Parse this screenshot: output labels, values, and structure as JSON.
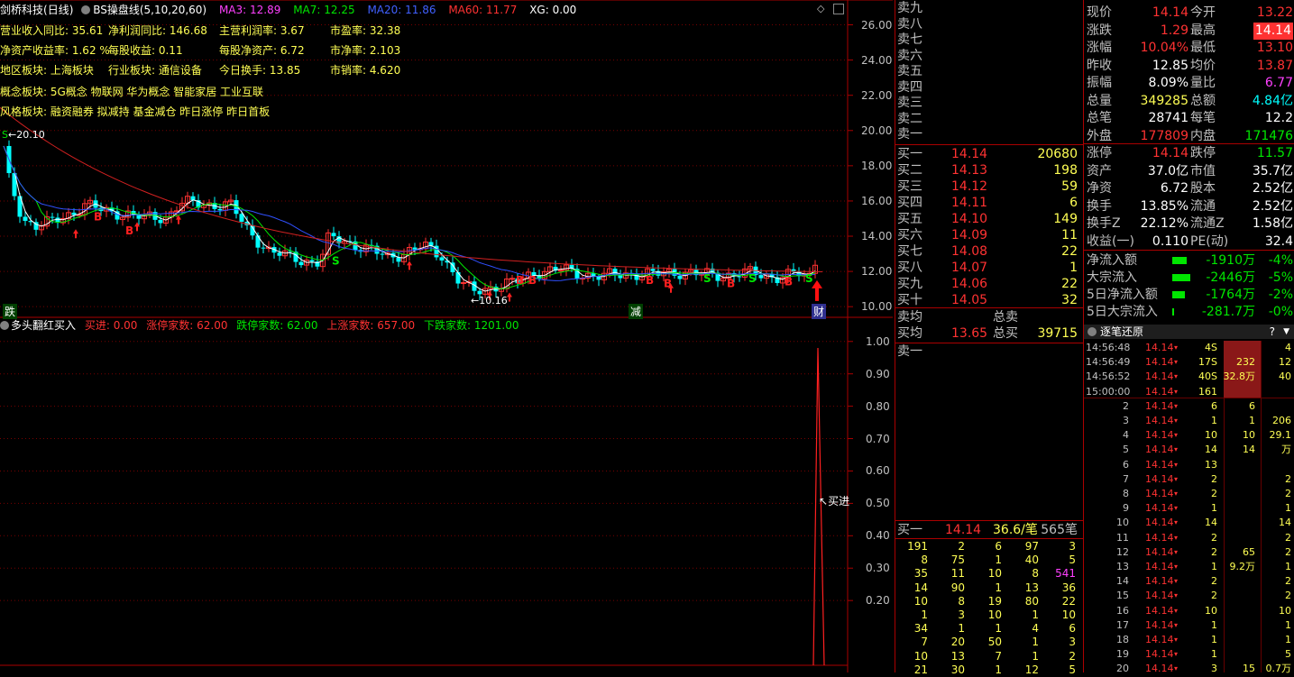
{
  "header": {
    "stock_name": "剑桥科技",
    "period": "(日线)",
    "indicator": "BS操盘线(5,10,20,60)",
    "ma3": "MA3: 12.89",
    "ma7": "MA7: 12.25",
    "ma20": "MA20: 11.86",
    "ma60": "MA60: 11.77",
    "xg": "XG: 0.00"
  },
  "fundamentals": {
    "row1": [
      "营业收入同比: 35.61",
      "净利润同比: 146.68",
      "主营利润率: 3.67",
      "市盈率: 32.38"
    ],
    "row2": [
      "净资产收益率: 1.62 %",
      "每股收益: 0.11",
      "每股净资产: 6.72",
      "市净率: 2.103"
    ],
    "row3": [
      "地区板块: 上海板块",
      "行业板块: 通信设备",
      "今日换手: 13.85",
      "市销率: 4.620"
    ],
    "concept": "概念板块: 5G概念 物联网 华为概念 智能家居 工业互联",
    "style": "风格板块: 融资融券 拟减持 基金减仓 昨日涨停 昨日首板"
  },
  "chart_labels": {
    "high_mark": "20.10",
    "low_mark": "10.16",
    "bottom_left": "跌",
    "bottom_mid": "减",
    "bottom_right": "财",
    "buy_sig": "B",
    "sell_sig": "S"
  },
  "price_axis": [
    "26.00",
    "24.00",
    "22.00",
    "20.00",
    "18.00",
    "16.00",
    "14.00",
    "12.00",
    "10.00"
  ],
  "sub_axis": [
    "1.00",
    "0.90",
    "0.80",
    "0.70",
    "0.60",
    "0.50",
    "0.40",
    "0.30",
    "0.20"
  ],
  "sub_header": {
    "name": "多头翻红买入",
    "buy": "买进: 0.00",
    "limit_up": "涨停家数: 62.00",
    "limit_down": "跌停家数: 62.00",
    "up": "上涨家数: 657.00",
    "down": "下跌家数: 1201.00",
    "annotation": "买进"
  },
  "chart_data": {
    "type": "candlestick",
    "ma_legend": [
      "MA3",
      "MA7",
      "MA20",
      "MA60"
    ],
    "ma_colors": [
      "#ffffff",
      "#ffff54",
      "#ff40ff",
      "#00e600"
    ],
    "price_range": [
      9.6,
      27.0
    ],
    "recent_high": 20.1,
    "recent_low": 10.16,
    "last_close": 14.14,
    "sub_range": [
      0,
      1.05
    ]
  },
  "orderbook": {
    "sell_labels": [
      "卖九",
      "卖八",
      "卖七",
      "卖六",
      "卖五",
      "卖四",
      "卖三",
      "卖二",
      "卖一"
    ],
    "buy_levels": [
      {
        "label": "买一",
        "price": "14.14",
        "vol": "20680"
      },
      {
        "label": "买二",
        "price": "14.13",
        "vol": "198"
      },
      {
        "label": "买三",
        "price": "14.12",
        "vol": "59"
      },
      {
        "label": "买四",
        "price": "14.11",
        "vol": "6"
      },
      {
        "label": "买五",
        "price": "14.10",
        "vol": "149"
      },
      {
        "label": "买六",
        "price": "14.09",
        "vol": "11"
      },
      {
        "label": "买七",
        "price": "14.08",
        "vol": "22"
      },
      {
        "label": "买八",
        "price": "14.07",
        "vol": "1"
      },
      {
        "label": "买九",
        "price": "14.06",
        "vol": "22"
      },
      {
        "label": "买十",
        "price": "14.05",
        "vol": "32"
      }
    ],
    "sell_avg_label": "卖均",
    "buy_avg_label": "买均",
    "buy_avg_price": "13.65",
    "total_sell_label": "总卖",
    "total_buy_label": "总买",
    "total_buy": "39715",
    "queue_sell_label": "卖一",
    "queue_buy_label": "买一",
    "queue_buy_price": "14.14",
    "queue_avg": "36.6/笔",
    "queue_count": "565笔",
    "queue": [
      [
        "191",
        "2",
        "6",
        "97",
        "3"
      ],
      [
        "8",
        "75",
        "1",
        "40",
        "5"
      ],
      [
        "35",
        "11",
        "10",
        "8",
        "541"
      ],
      [
        "14",
        "90",
        "1",
        "13",
        "36"
      ],
      [
        "10",
        "8",
        "19",
        "80",
        "22"
      ],
      [
        "1",
        "3",
        "10",
        "1",
        "10"
      ],
      [
        "34",
        "1",
        "1",
        "4",
        "6"
      ],
      [
        "7",
        "20",
        "50",
        "1",
        "3"
      ],
      [
        "10",
        "13",
        "7",
        "1",
        "2"
      ],
      [
        "21",
        "30",
        "1",
        "12",
        "5"
      ]
    ]
  },
  "quote": {
    "rows1": [
      {
        "l1": "现价",
        "v1": "14.14",
        "c1": "red",
        "l2": "今开",
        "v2": "13.22",
        "c2": "red"
      },
      {
        "l1": "涨跌",
        "v1": "1.29",
        "c1": "red",
        "l2": "最高",
        "v2": "14.14",
        "c2": "red"
      },
      {
        "l1": "涨幅",
        "v1": "10.04%",
        "c1": "red",
        "l2": "最低",
        "v2": "13.10",
        "c2": "red"
      },
      {
        "l1": "昨收",
        "v1": "12.85",
        "c1": "wht",
        "l2": "均价",
        "v2": "13.87",
        "c2": "red"
      },
      {
        "l1": "振幅",
        "v1": "8.09%",
        "c1": "wht",
        "l2": "量比",
        "v2": "6.77",
        "c2": "mag"
      },
      {
        "l1": "总量",
        "v1": "349285",
        "c1": "yel",
        "l2": "总额",
        "v2": "4.84亿",
        "c2": "cyan"
      },
      {
        "l1": "总笔",
        "v1": "28741",
        "c1": "wht",
        "l2": "每笔",
        "v2": "12.2",
        "c2": "wht"
      },
      {
        "l1": "外盘",
        "v1": "177809",
        "c1": "red",
        "l2": "内盘",
        "v2": "171476",
        "c2": "grn"
      }
    ],
    "rows2": [
      {
        "l1": "涨停",
        "v1": "14.14",
        "c1": "red",
        "l2": "跌停",
        "v2": "11.57",
        "c2": "grn"
      },
      {
        "l1": "资产",
        "v1": "37.0亿",
        "c1": "wht",
        "l2": "市值",
        "v2": "35.7亿",
        "c2": "wht"
      },
      {
        "l1": "净资",
        "v1": "6.72",
        "c1": "wht",
        "l2": "股本",
        "v2": "2.52亿",
        "c2": "wht"
      },
      {
        "l1": "换手",
        "v1": "13.85%",
        "c1": "wht",
        "l2": "流通",
        "v2": "2.52亿",
        "c2": "wht"
      },
      {
        "l1": "换手Z",
        "v1": "22.12%",
        "c1": "wht",
        "l2": "流通Z",
        "v2": "1.58亿",
        "c2": "wht"
      },
      {
        "l1": "收益(一)",
        "v1": "0.110",
        "c1": "wht",
        "l2": "PE(动)",
        "v2": "32.4",
        "c2": "wht"
      }
    ],
    "flows": [
      {
        "label": "净流入额",
        "value": "-1910万",
        "pct": "-4%",
        "bar": 0.8
      },
      {
        "label": "大宗流入",
        "value": "-2446万",
        "pct": "-5%",
        "bar": 1.0
      },
      {
        "label": "5日净流入额",
        "value": "-1764万",
        "pct": "-2%",
        "bar": 0.7
      },
      {
        "label": "5日大宗流入",
        "value": "-281.7万",
        "pct": "-0%",
        "bar": 0.06
      }
    ]
  },
  "ticks": {
    "title": "逐笔还原",
    "rows": [
      {
        "t": "14:56:48",
        "p": "14.14",
        "v": "4S",
        "c1": "",
        "c2": "4"
      },
      {
        "t": "14:56:49",
        "p": "14.14",
        "v": "17S",
        "c1": "232",
        "c2": "12"
      },
      {
        "t": "14:56:52",
        "p": "14.14",
        "v": "40S",
        "c1": "32.8万",
        "c2": "40"
      },
      {
        "t": "15:00:00",
        "p": "14.14",
        "v": "161",
        "c1": "",
        "c2": ""
      },
      {
        "t": "2",
        "p": "14.14",
        "v": "6",
        "c1": "6",
        "c2": ""
      },
      {
        "t": "3",
        "p": "14.14",
        "v": "1",
        "c1": "1",
        "c2": "206"
      },
      {
        "t": "4",
        "p": "14.14",
        "v": "10",
        "c1": "10",
        "c2": "29.1万"
      },
      {
        "t": "5",
        "p": "14.14",
        "v": "14",
        "c1": "14",
        "c2": ""
      },
      {
        "t": "6",
        "p": "14.14",
        "v": "13",
        "c1": "",
        "c2": ""
      },
      {
        "t": "7",
        "p": "14.14",
        "v": "2",
        "c1": "",
        "c2": "2"
      },
      {
        "t": "8",
        "p": "14.14",
        "v": "2",
        "c1": "",
        "c2": "2"
      },
      {
        "t": "9",
        "p": "14.14",
        "v": "1",
        "c1": "",
        "c2": "1"
      },
      {
        "t": "10",
        "p": "14.14",
        "v": "14",
        "c1": "",
        "c2": "14"
      },
      {
        "t": "11",
        "p": "14.14",
        "v": "2",
        "c1": "",
        "c2": "2"
      },
      {
        "t": "12",
        "p": "14.14",
        "v": "2",
        "c1": "65",
        "c2": "2"
      },
      {
        "t": "13",
        "p": "14.14",
        "v": "1",
        "c1": "9.2万",
        "c2": "1"
      },
      {
        "t": "14",
        "p": "14.14",
        "v": "2",
        "c1": "",
        "c2": "2"
      },
      {
        "t": "15",
        "p": "14.14",
        "v": "2",
        "c1": "",
        "c2": "2"
      },
      {
        "t": "16",
        "p": "14.14",
        "v": "10",
        "c1": "",
        "c2": "10"
      },
      {
        "t": "17",
        "p": "14.14",
        "v": "1",
        "c1": "",
        "c2": "1"
      },
      {
        "t": "18",
        "p": "14.14",
        "v": "1",
        "c1": "",
        "c2": "1"
      },
      {
        "t": "19",
        "p": "14.14",
        "v": "1",
        "c1": "",
        "c2": "5"
      },
      {
        "t": "20",
        "p": "14.14",
        "v": "3",
        "c1": "15",
        "c2": "0.7万"
      }
    ]
  }
}
